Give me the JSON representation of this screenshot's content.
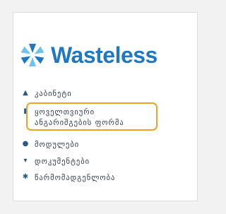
{
  "brand": {
    "name": "Wasteless",
    "colors": {
      "text": "#1f78c2",
      "mark_dark": "#1f78c2",
      "mark_light": "#6fc3e8"
    }
  },
  "menu": {
    "items": [
      {
        "label": "კაბინეტი",
        "icon": "dashboard-icon"
      },
      {
        "label_line1": "ყოველთვიური",
        "label_line2": "ანგარიშგების ფორმა",
        "icon": "report-icon",
        "highlighted": true
      },
      {
        "label": "მოდულები",
        "icon": "modules-icon"
      },
      {
        "label": "დოკუმენტები",
        "icon": "documents-icon"
      },
      {
        "label": "წარმომადგენლობა",
        "icon": "representation-icon"
      }
    ]
  },
  "highlight": {
    "color": "#f0a323"
  }
}
